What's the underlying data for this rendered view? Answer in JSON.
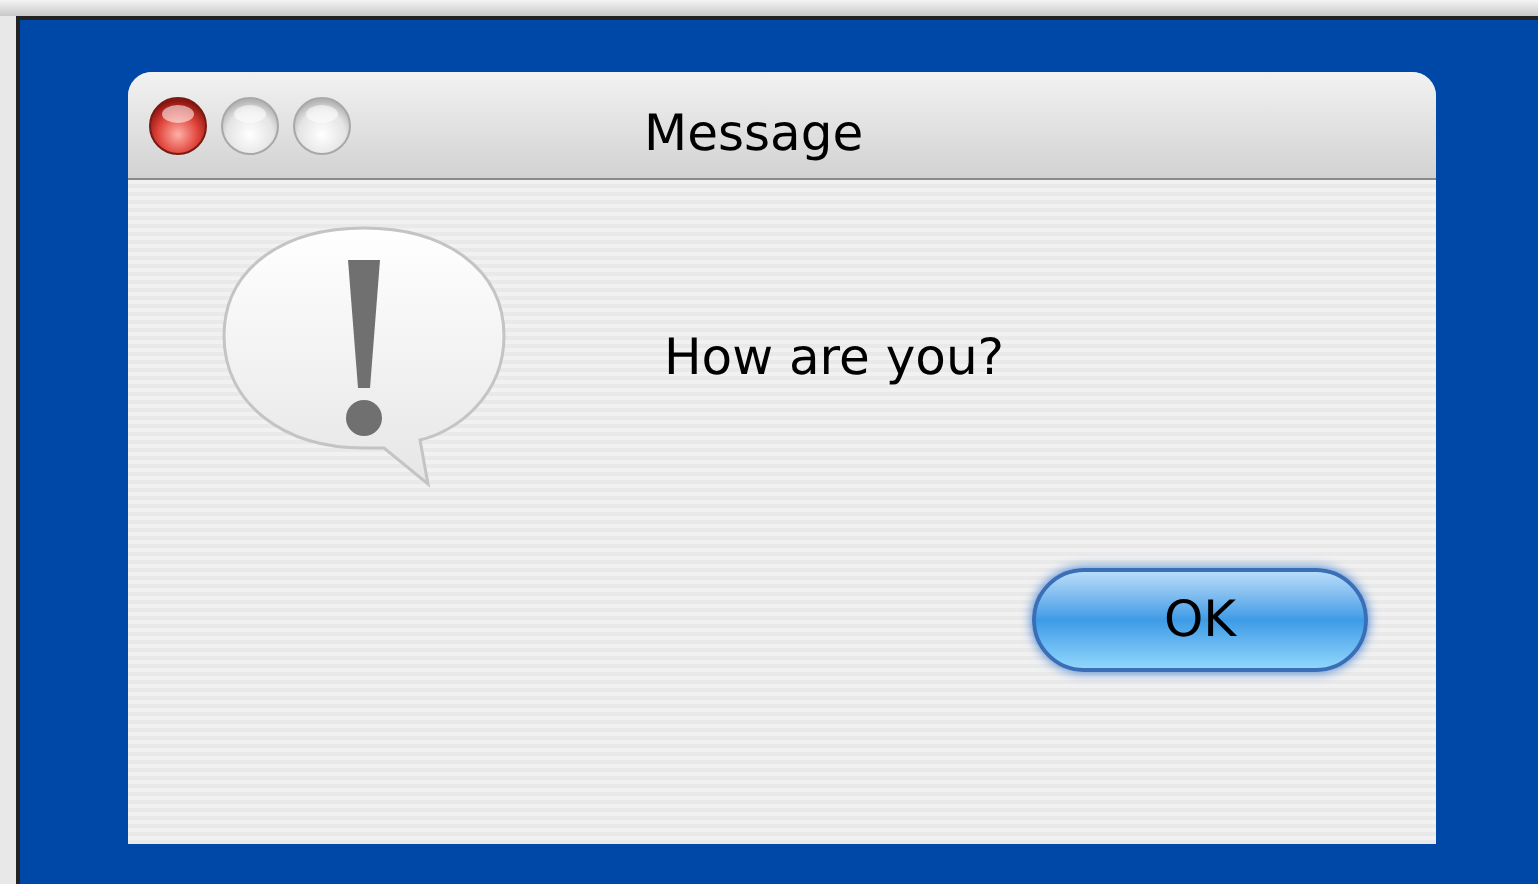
{
  "window": {
    "title": "Message"
  },
  "message": "How are you?",
  "buttons": [
    {
      "label": "OK",
      "default": true
    }
  ]
}
